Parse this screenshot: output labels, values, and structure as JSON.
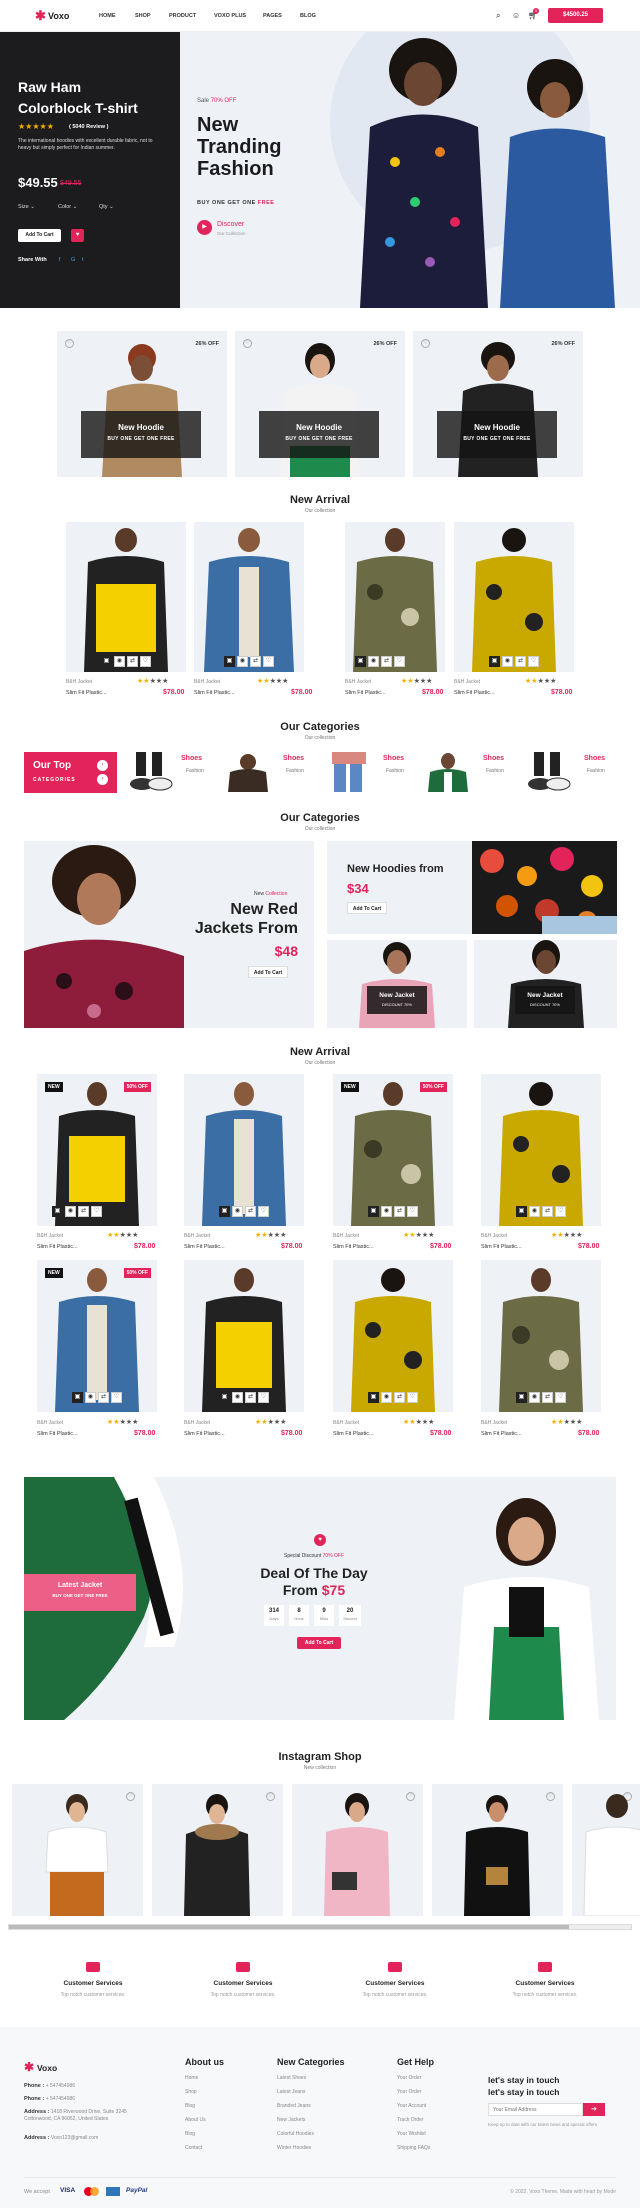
{
  "header": {
    "logo": "Voxo",
    "nav": [
      "HOME",
      "SHOP",
      "PRODUCT",
      "VOXO PLUS",
      "PAGES",
      "BLOG"
    ],
    "cart_count": "0",
    "cart_button": "$4500.25"
  },
  "hero": {
    "title_line1": "Raw Ham",
    "title_line2": "Colorblock T-shirt",
    "review": "( 5040 Review )",
    "desc": "The international hoodies with excellent durable fabric, not to heavy but simply perfect for Indian summer.",
    "price": "$49.55",
    "old_price": "$49.55",
    "size": "Size",
    "color": "Color",
    "qty": "Qty",
    "add_to_cart": "Add To Cart",
    "share_with": "Share With",
    "sale": "Sale",
    "sale_off": "70% OFF",
    "headline1": "New",
    "headline2": "Tranding",
    "headline3": "Fashion",
    "bogo_prefix": "BUY ONE GET ONE",
    "bogo_free": "FREE",
    "discover": "Discover",
    "our_collection": "Our Collection"
  },
  "offers": [
    {
      "off": "26% OFF",
      "title": "New Hoodie",
      "sub": "BUY ONE GET ONE FREE"
    },
    {
      "off": "26% OFF",
      "title": "New Hoodie",
      "sub": "BUY ONE GET ONE FREE"
    },
    {
      "off": "26% OFF",
      "title": "New Hoodie",
      "sub": "BUY ONE GET ONE FREE"
    }
  ],
  "new_arrival_1": {
    "title": "New Arrival",
    "sub": "Our collection",
    "products": [
      {
        "tag": "B&H Jacket",
        "name": "Slim Fit Plastic...",
        "price": "$78.00"
      },
      {
        "tag": "B&H Jacket",
        "name": "Slim Fit Plastic...",
        "price": "$78.00"
      },
      {
        "tag": "B&H Jacket",
        "name": "Slim Fit Plastic...",
        "price": "$78.00"
      },
      {
        "tag": "B&H Jacket",
        "name": "Slim Fit Plastic...",
        "price": "$78.00"
      }
    ]
  },
  "categories_1": {
    "title": "Our Categories",
    "sub": "Our collection",
    "top": "Our Top",
    "top_sub": "CATEGORIES",
    "items": [
      {
        "name": "Shoes",
        "sub": "Fashion"
      },
      {
        "name": "Shoes",
        "sub": "Fashion"
      },
      {
        "name": "Shoes",
        "sub": "Fashion"
      },
      {
        "name": "Shoes",
        "sub": "Fashion"
      },
      {
        "name": "Shoes",
        "sub": "Fashion"
      }
    ]
  },
  "categories_2": {
    "title": "Our Categories",
    "sub": "Our collection",
    "new_label": "New",
    "collection_label": "Collection",
    "jacket_title1": "New Red",
    "jacket_title2": "Jackets From",
    "jacket_price": "$48",
    "add_to_cart": "Add To Cart",
    "hoodies_title": "New Hoodies from",
    "hoodies_price": "$34",
    "new_jacket": "New Jacket",
    "discount": "DISCOUNT 70%"
  },
  "new_arrival_2": {
    "title": "New Arrival",
    "sub": "Our collection",
    "badge_new": "NEW",
    "badge_off": "50% OFF",
    "products": [
      {
        "tag": "B&H Jacket",
        "name": "Slim Fit Plastic...",
        "price": "$78.00"
      },
      {
        "tag": "B&H Jacket",
        "name": "Slim Fit Plastic...",
        "price": "$78.00"
      },
      {
        "tag": "B&H Jacket",
        "name": "Slim Fit Plastic...",
        "price": "$78.00"
      },
      {
        "tag": "B&H Jacket",
        "name": "Slim Fit Plastic...",
        "price": "$78.00"
      },
      {
        "tag": "B&H Jacket",
        "name": "Slim Fit Plastic...",
        "price": "$78.00"
      },
      {
        "tag": "B&H Jacket",
        "name": "Slim Fit Plastic...",
        "price": "$78.00"
      },
      {
        "tag": "B&H Jacket",
        "name": "Slim Fit Plastic...",
        "price": "$78.00"
      },
      {
        "tag": "B&H Jacket",
        "name": "Slim Fit Plastic...",
        "price": "$78.00"
      }
    ]
  },
  "deal": {
    "latest": "Latest Jacket",
    "bogo": "BUY ONE GET ONE FREE",
    "special": "Special Discount",
    "special_off": "70% OFF",
    "title1": "Deal Of The Day",
    "title2_prefix": "From",
    "price": "$75",
    "timer": [
      {
        "v": "314",
        "l": "Days"
      },
      {
        "v": "8",
        "l": "Hous"
      },
      {
        "v": "9",
        "l": "Mins"
      },
      {
        "v": "20",
        "l": "Second"
      }
    ],
    "add_to_cart": "Add To Cart"
  },
  "instagram": {
    "title": "Instagram Shop",
    "sub": "New collection"
  },
  "services": [
    {
      "title": "Customer Services",
      "sub": "Top notch customer services."
    },
    {
      "title": "Customer Services",
      "sub": "Top notch customer services."
    },
    {
      "title": "Customer Services",
      "sub": "Top notch customer services."
    },
    {
      "title": "Customer Services",
      "sub": "Top notch customer services."
    }
  ],
  "footer": {
    "logo": "Voxo",
    "phone1_label": "Phone :",
    "phone1": "+ 547454986",
    "phone2_label": "Phone :",
    "phone2": "+ 547454986",
    "address_label": "Address :",
    "address": "1418 Riverwood Drive, Suite 3245 Cottonwood, CA 96052, United States",
    "email_label": "Address :",
    "email": "Voxo123@gmail.com",
    "col1": {
      "title": "About us",
      "links": [
        "Home",
        "Shop",
        "Blog",
        "About Us",
        "Blog",
        "Contact"
      ]
    },
    "col2": {
      "title": "New Categories",
      "links": [
        "Latest Shoes",
        "Latest Jeans",
        "Branded Jeans",
        "New Jackets",
        "Colorful Hoodies",
        "Winter Hoodies"
      ]
    },
    "col3": {
      "title": "Get Help",
      "links": [
        "Your Order",
        "Your Order",
        "Your Account",
        "Track Order",
        "Your Wishlist",
        "Shipping FAQs"
      ]
    },
    "news_title1": "let's stay in touch",
    "news_title2": "let's stay in touch",
    "news_placeholder": "Your Email Address",
    "news_note": "Keep up to date with our latest news and special offers",
    "we_accept": "We accept",
    "payments": [
      "VISA",
      "PayPal"
    ],
    "copyright": "© 2022, Voxo Theme. Made with heart by Mode"
  },
  "colors": {
    "accent": "#e2245b",
    "dark": "#1c1c1f"
  }
}
